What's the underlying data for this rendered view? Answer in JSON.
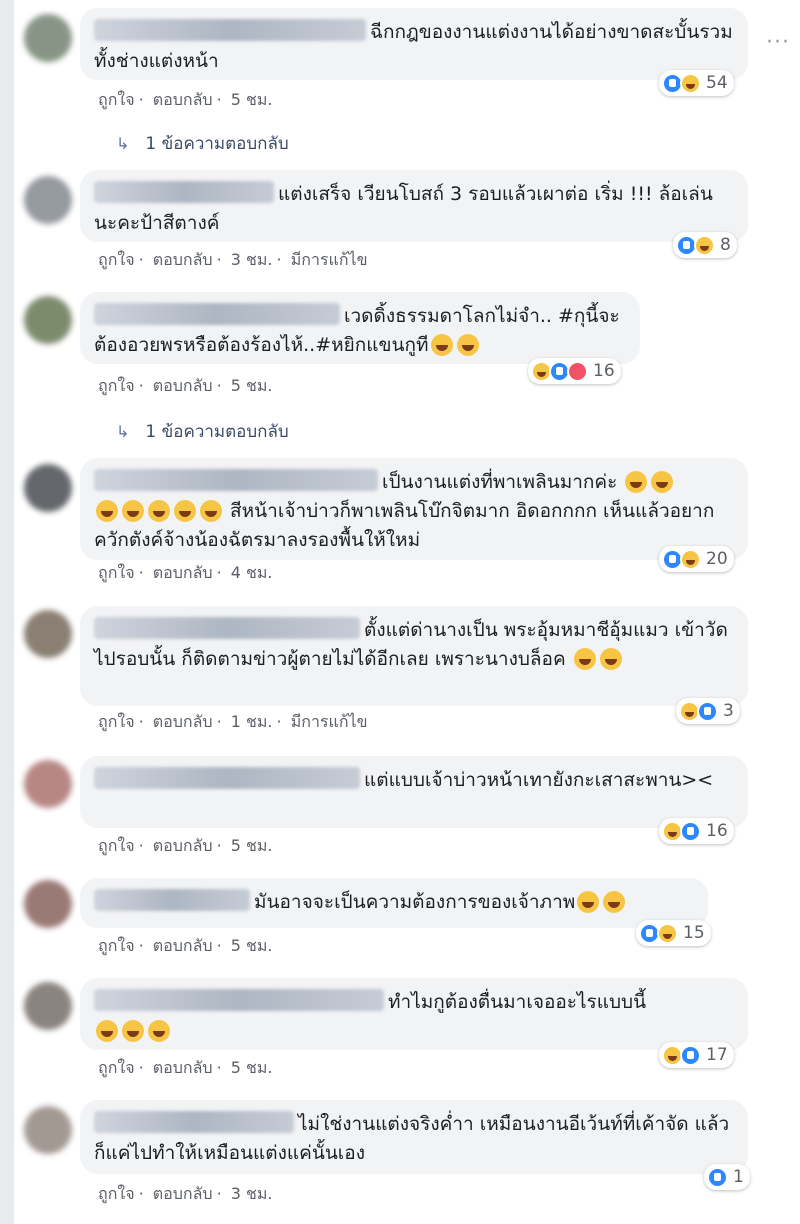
{
  "actions": {
    "like": "ถูกใจ",
    "reply": "ตอบกลับ",
    "edited": "มีการแก้ไข",
    "sep": "·"
  },
  "more_label": "···",
  "comments": [
    {
      "text": "ฉีกกฎของงานแต่งงานได้อย่างขาดสะบั้นรวมทั้งช่างแต่งหน้า",
      "time": "5 ชม.",
      "reactions": "54",
      "reply_label": "1 ข้อความตอบกลับ"
    },
    {
      "text": "แต่งเสร็จ เวียนโบสถ์ 3 รอบแล้วเผาต่อ เริ่ม !!! ล้อเล่นนะคะป้าสีตางค์",
      "time": "3 ชม.",
      "reactions": "8"
    },
    {
      "text": "เวดดิ้งธรรมดาโลกไม่จำ.. #กุนี้จะต้องอวยพรหรือต้องร้องไห้..#หยิกแขนกูที",
      "time": "5 ชม.",
      "reactions": "16",
      "reply_label": "1 ข้อความตอบกลับ"
    },
    {
      "text": "เป็นงานแต่งที่พาเพลินมากค่ะ",
      "text2": "สีหน้าเจ้าบ่าวก็พาเพลินโบ๊กจิตมาก อิดอกกกก เห็นแล้วอยากควักตังค์จ้างน้องฉัตรมาลงรองพื้นให้ใหม่",
      "time": "4 ชม.",
      "reactions": "20"
    },
    {
      "text": "ตั้งแต่ด่านางเป็น พระอุ้มหมาชีอุ้มแมว เข้าวัดไปรอบนั้น ก็ติดตามข่าวผู้ตายไม่ได้อีกเลย เพราะนางบล็อค",
      "time": "1 ชม.",
      "reactions": "3"
    },
    {
      "text": "แต่แบบเจ้าบ่าวหน้าเทายังกะเสาสะพาน><",
      "time": "5 ชม.",
      "reactions": "16"
    },
    {
      "text": "มันอาจจะเป็นความต้องการของเจ้าภาพ",
      "time": "5 ชม.",
      "reactions": "15"
    },
    {
      "text": "ทำไมกูต้องตื่นมาเจออะไรแบบนี้",
      "time": "5 ชม.",
      "reactions": "17"
    },
    {
      "text": "ไม่ใช่งานแต่งจริงค่ำา เหมือนงานอีเว้นท์ที่เค้าจัด แล้วก็แค่ไปทำให้เหมือนแต่งแค่นั้นเอง",
      "time": "3 ชม.",
      "reactions": "1"
    }
  ]
}
